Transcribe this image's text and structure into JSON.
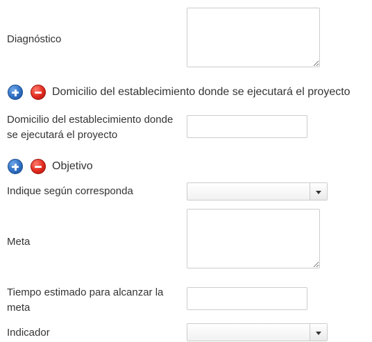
{
  "diagnostico": {
    "label": "Diagnóstico",
    "value": ""
  },
  "section_domicilio": {
    "title": "Domicilio del establecimiento donde se ejecutará el proyecto",
    "add_icon": "plus-circle-icon",
    "remove_icon": "minus-circle-icon"
  },
  "domicilio": {
    "label": "Domicilio del establecimiento donde se ejecutará el proyecto",
    "value": ""
  },
  "section_objetivo": {
    "title": "Objetivo",
    "add_icon": "plus-circle-icon",
    "remove_icon": "minus-circle-icon"
  },
  "indique": {
    "label": "Indique según corresponda",
    "selected": ""
  },
  "meta": {
    "label": "Meta",
    "value": ""
  },
  "tiempo": {
    "label": "Tiempo estimado para alcanzar la meta",
    "value": ""
  },
  "indicador": {
    "label": "Indicador",
    "selected": ""
  },
  "colors": {
    "add_icon": "#2f6fc2",
    "remove_icon": "#e02a1e",
    "border": "#cccccc",
    "text": "#333333"
  }
}
